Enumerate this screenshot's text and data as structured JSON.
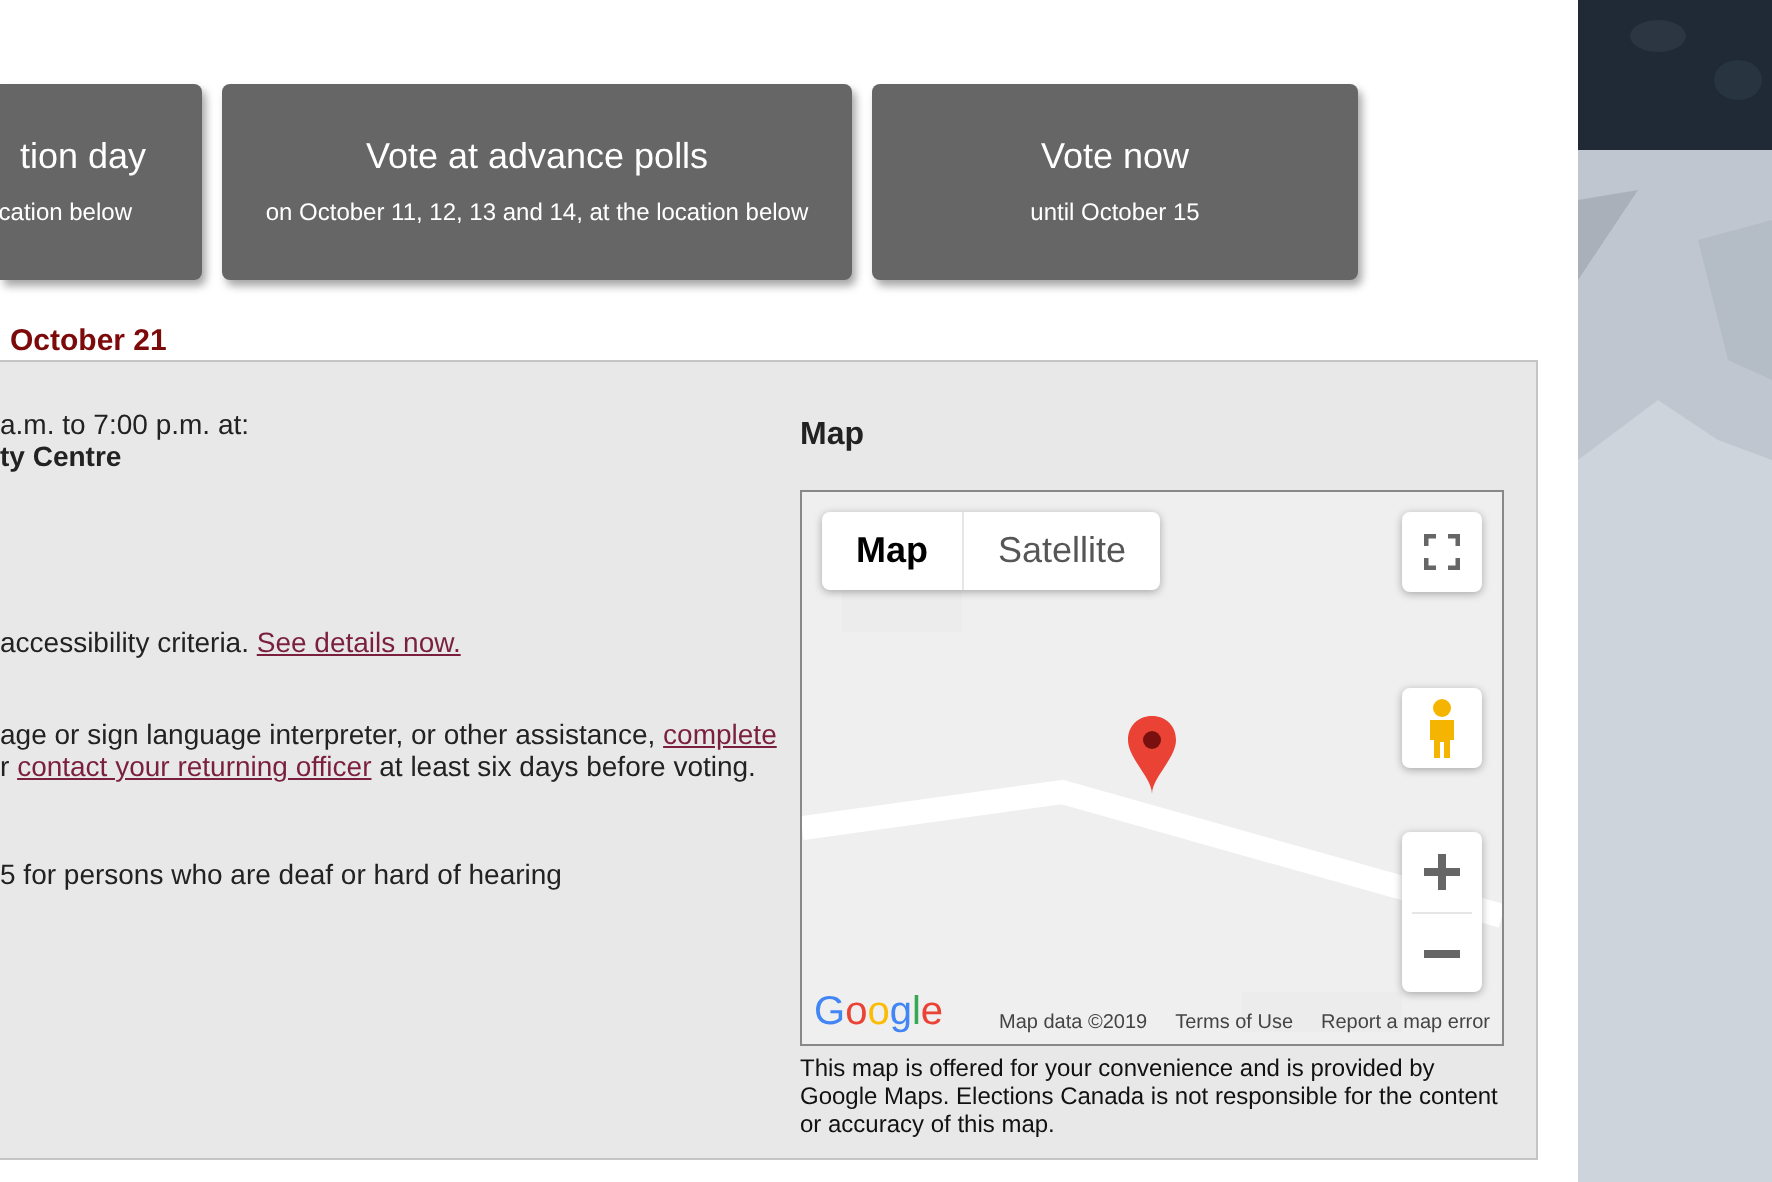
{
  "cards": [
    {
      "title": "tion day",
      "subtitle": "cation below"
    },
    {
      "title": "Vote at advance polls",
      "subtitle": "on October 11, 12, 13 and 14, at the location below"
    },
    {
      "title": "Vote now",
      "subtitle": "until October 15"
    }
  ],
  "section_heading": "October 21",
  "details": [
    {
      "lines": [
        [
          {
            "kind": "text",
            "text": "a.m. to 7:00 p.m. at:"
          }
        ],
        [
          {
            "kind": "bold",
            "text": "ty Centre"
          }
        ]
      ]
    },
    {
      "lines": [
        [
          {
            "kind": "text",
            "text": "accessibility criteria. "
          },
          {
            "kind": "link",
            "text": "See details now."
          }
        ]
      ]
    },
    {
      "lines": [
        [
          {
            "kind": "text",
            "text": "age or sign language interpreter, or other assistance, "
          },
          {
            "kind": "link",
            "text": "complete"
          }
        ],
        [
          {
            "kind": "text",
            "text": "r "
          },
          {
            "kind": "link",
            "text": "contact your returning officer"
          },
          {
            "kind": "text",
            "text": " at least six days before voting."
          }
        ]
      ]
    },
    {
      "lines": [
        [
          {
            "kind": "text",
            "text": "5 for persons who are deaf or hard of hearing"
          }
        ]
      ]
    }
  ],
  "map": {
    "title": "Map",
    "map_types": [
      {
        "label": "Map",
        "selected": true
      },
      {
        "label": "Satellite",
        "selected": false
      }
    ],
    "logo": "Google",
    "attribution": [
      "Map data ©2019",
      "Terms of Use",
      "Report a map error"
    ],
    "caption": "This map is offered for your convenience and is provided by Google Maps. Elections Canada is not responsible for the content or accuracy of this map."
  }
}
